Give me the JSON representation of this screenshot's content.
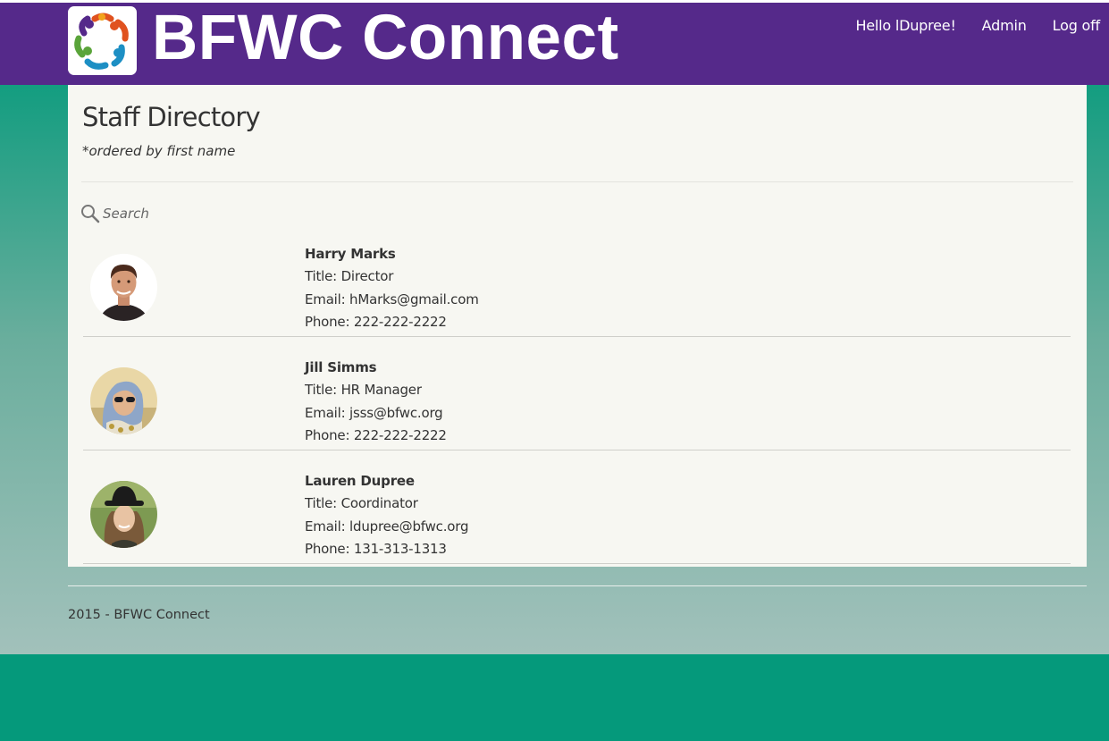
{
  "header": {
    "brand": "BFWC Connect",
    "nav": [
      {
        "label": "Hello lDupree!"
      },
      {
        "label": "Admin"
      },
      {
        "label": "Log off"
      }
    ]
  },
  "page": {
    "title": "Staff Directory",
    "subtitle": "*ordered by first name",
    "search_placeholder": "Search"
  },
  "staff": [
    {
      "name": "Harry Marks",
      "title": "Title: Director",
      "email": "Email: hMarks@gmail.com",
      "phone": "Phone: 222-222-2222"
    },
    {
      "name": "Jill Simms",
      "title": "Title: HR Manager",
      "email": "Email: jsss@bfwc.org",
      "phone": "Phone: 222-222-2222"
    },
    {
      "name": "Lauren Dupree",
      "title": "Title: Coordinator",
      "email": "Email: ldupree@bfwc.org",
      "phone": "Phone: 131-313-1313"
    }
  ],
  "footer": {
    "text": "2015 - BFWC Connect"
  },
  "colors": {
    "header": "#55298a",
    "accent": "#05997b",
    "panel": "#f7f7f2"
  }
}
